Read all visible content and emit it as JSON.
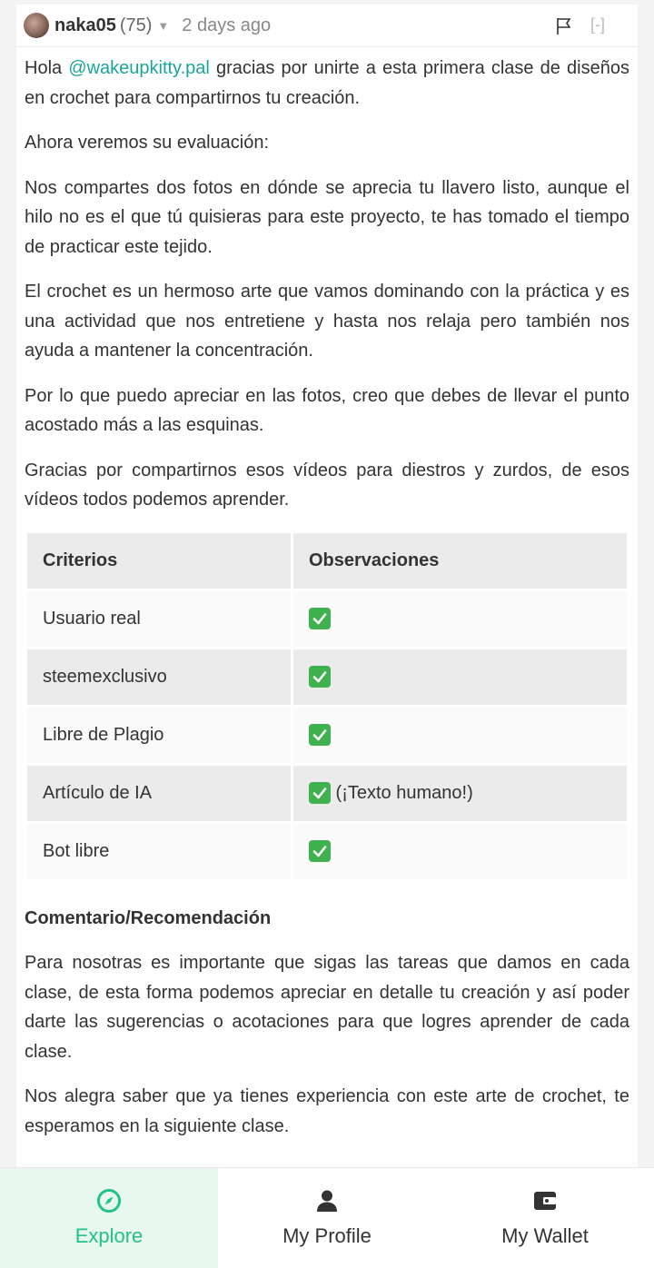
{
  "comment": {
    "author": "naka05",
    "reputation": "(75)",
    "time": "2 days ago",
    "collapse": "[-]",
    "greeting_prefix": "Hola ",
    "mention": "@wakeupkitty.pal",
    "greeting_suffix": " gracias por unirte a esta primera clase de diseños en crochet para compartirnos tu creación.",
    "paragraphs": [
      "Ahora veremos su evaluación:",
      "Nos compartes dos fotos en dónde se aprecia tu llavero listo, aunque el hilo no es el que tú quisieras para este proyecto, te has tomado el tiempo de practicar este tejido.",
      "El crochet es un hermoso arte que vamos dominando con la práctica y es una actividad que nos entretiene y hasta nos relaja pero también nos ayuda a mantener la concentración.",
      "Por lo que puedo apreciar en las fotos, creo que debes de llevar el punto acostado más a las esquinas.",
      "Gracias por compartirnos esos vídeos para diestros y zurdos, de esos vídeos todos podemos aprender."
    ],
    "table": {
      "headers": [
        "Criterios",
        "Observaciones"
      ],
      "rows": [
        {
          "criterio": "Usuario real",
          "note": ""
        },
        {
          "criterio": "steemexclusivo",
          "note": ""
        },
        {
          "criterio": "Libre de Plagio",
          "note": ""
        },
        {
          "criterio": "Artículo de IA",
          "note": " (¡Texto humano!)"
        },
        {
          "criterio": "Bot libre",
          "note": ""
        }
      ]
    },
    "subheading": "Comentario/Recomendación",
    "closing": [
      "Para nosotras es importante que sigas las tareas que damos en cada clase, de esta forma podemos apreciar en detalle tu creación y así poder darte las sugerencias o acotaciones para que logres aprender de cada clase.",
      "Nos alegra saber que ya tienes experiencia con este arte de crochet, te esperamos en la siguiente clase."
    ]
  },
  "nav": {
    "explore": "Explore",
    "profile": "My Profile",
    "wallet": "My Wallet"
  },
  "colors": {
    "accent": "#22c28a",
    "link": "#1aa59a",
    "check": "#3fb24f"
  }
}
